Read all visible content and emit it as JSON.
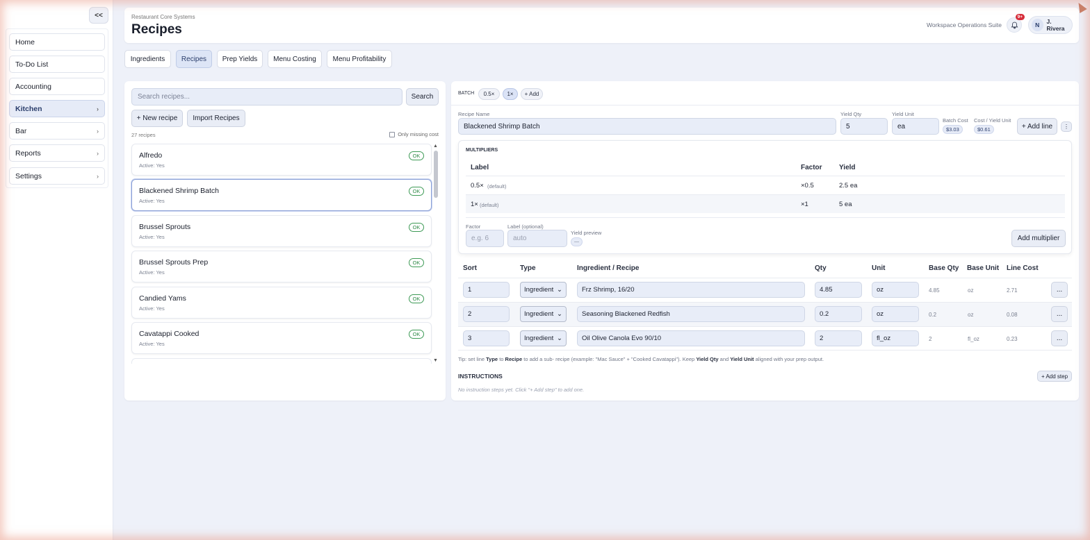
{
  "sidebar": {
    "collapse_label": "<<",
    "items": [
      {
        "label": "Home",
        "chev": ""
      },
      {
        "label": "To-Do List",
        "chev": ""
      },
      {
        "label": "Accounting",
        "chev": ""
      },
      {
        "label": "Kitchen",
        "chev": "›"
      },
      {
        "label": "Bar",
        "chev": "›"
      },
      {
        "label": "Reports",
        "chev": "›"
      },
      {
        "label": "Settings",
        "chev": "›"
      }
    ]
  },
  "header": {
    "breadcrumb": "Restaurant Core Systems",
    "title": "Recipes",
    "suite": "Workspace Operations Suite",
    "notif_count": "9+",
    "user_initial": "N",
    "user_name": "J. Rivera"
  },
  "tabs": [
    "Ingredients",
    "Recipes",
    "Prep Yields",
    "Menu Costing",
    "Menu Profitability"
  ],
  "left": {
    "search_placeholder": "Search recipes...",
    "search_btn": "Search",
    "new_btn": "+ New recipe",
    "import_btn": "Import Recipes",
    "count": "27 recipes",
    "only_missing": "Only missing cost",
    "recipes": [
      {
        "name": "Alfredo",
        "sub": "Active: Yes",
        "status": "OK"
      },
      {
        "name": "Blackened Shrimp Batch",
        "sub": "Active: Yes",
        "status": "OK"
      },
      {
        "name": "Brussel Sprouts",
        "sub": "Active: Yes",
        "status": "OK"
      },
      {
        "name": "Brussel Sprouts Prep",
        "sub": "Active: Yes",
        "status": "OK"
      },
      {
        "name": "Candied Yams",
        "sub": "Active: Yes",
        "status": "OK"
      },
      {
        "name": "Cavatappi Cooked",
        "sub": "Active: Yes",
        "status": "OK"
      }
    ]
  },
  "detail": {
    "batch_label": "BATCH",
    "batch_pills": [
      "0.5×",
      "1×",
      "+ Add"
    ],
    "recipe_name_label": "Recipe Name",
    "recipe_name": "Blackened Shrimp Batch",
    "yield_qty_label": "Yield Qty",
    "yield_qty": "5",
    "yield_unit_label": "Yield Unit",
    "yield_unit": "ea",
    "batch_cost_label": "Batch Cost",
    "batch_cost": "$3.03",
    "cost_yield_label": "Cost / Yield Unit",
    "cost_yield": "$0.61",
    "add_line": "+ Add line",
    "kebab": "⋮",
    "multipliers": {
      "title": "MULTIPLIERS",
      "headers": [
        "Label",
        "Factor",
        "Yield"
      ],
      "rows": [
        {
          "label": "0.5×",
          "tag": "(default)",
          "factor": "×0.5",
          "yield": "2.5 ea"
        },
        {
          "label": "1×",
          "tag": "(default)",
          "factor": "×1",
          "yield": "5 ea"
        }
      ],
      "factor_label": "Factor",
      "factor_placeholder": "e.g. 6",
      "label_label": "Label (optional)",
      "label_placeholder": "auto",
      "preview_label": "Yield preview",
      "preview_value": "—",
      "add_btn": "Add multiplier"
    },
    "lines": {
      "headers": [
        "Sort",
        "Type",
        "Ingredient / Recipe",
        "Qty",
        "Unit",
        "Base Qty",
        "Base Unit",
        "Line Cost"
      ],
      "rows": [
        {
          "sort": "1",
          "type": "Ingredient",
          "item": "Frz Shrimp, 16/20",
          "qty": "4.85",
          "unit": "oz",
          "base_qty": "4.85",
          "base_unit": "oz",
          "cost": "2.71"
        },
        {
          "sort": "2",
          "type": "Ingredient",
          "item": "Seasoning Blackened Redfish",
          "qty": "0.2",
          "unit": "oz",
          "base_qty": "0.2",
          "base_unit": "oz",
          "cost": "0.08"
        },
        {
          "sort": "3",
          "type": "Ingredient",
          "item": "Oil Olive Canola Evo 90/10",
          "qty": "2",
          "unit": "fl_oz",
          "base_qty": "2",
          "base_unit": "fl_oz",
          "cost": "0.23"
        }
      ],
      "more": "..."
    },
    "tip": {
      "a": "Tip: set line ",
      "b": "Type",
      "c": " to ",
      "d": "Recipe",
      "e": " to add a sub- recipe (example: \"Mac Sauce\" + \"Cooked Cavatappi\"). Keep ",
      "f": "Yield Qty",
      "g": " and ",
      "h": "Yield Unit",
      "i": " aligned with your prep output."
    },
    "instructions_title": "INSTRUCTIONS",
    "add_step": "+ Add step",
    "no_steps": "No instruction steps yet. Click \"+ Add step\" to add one."
  }
}
